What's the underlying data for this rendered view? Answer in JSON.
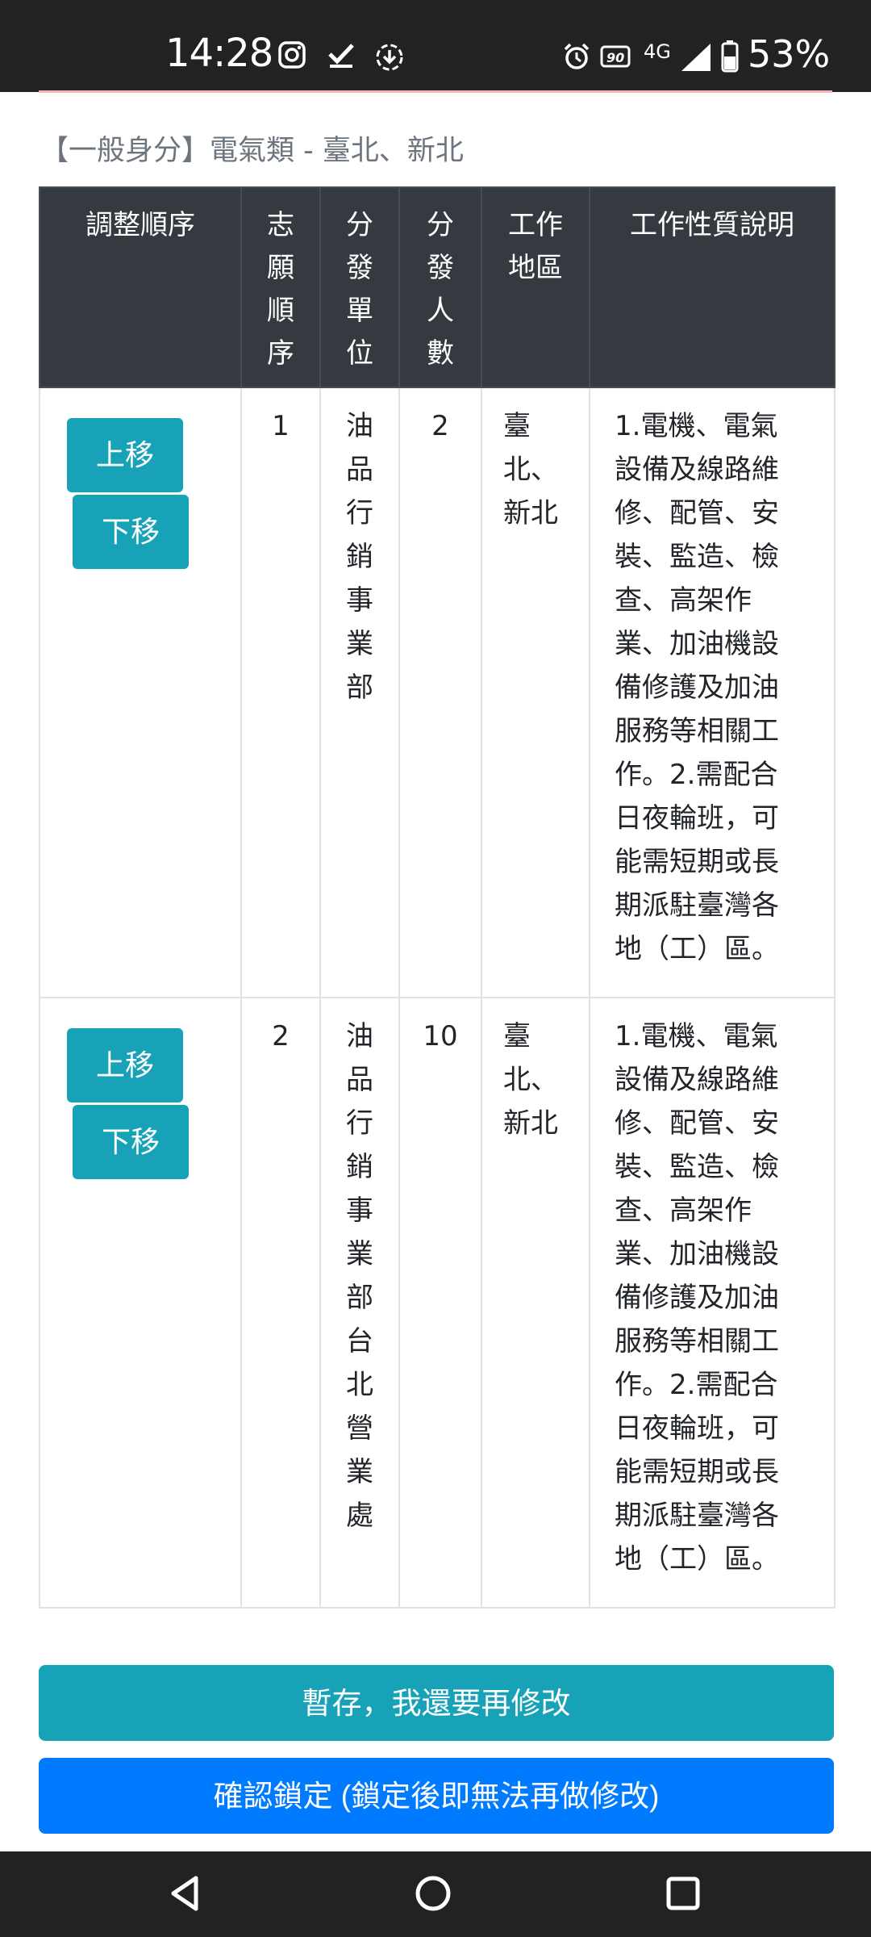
{
  "status_bar": {
    "time": "14:28",
    "network": "4G",
    "battery": "53%"
  },
  "section": {
    "title": "【一般身分】電氣類 - 臺北、新北"
  },
  "table": {
    "headers": {
      "adjust": "調整順序",
      "order": "志願順序",
      "unit": "分發單位",
      "count": "分發人數",
      "area": "工作地區",
      "desc": "工作性質說明"
    },
    "rows": [
      {
        "up_label": "上移",
        "down_label": "下移",
        "order": "1",
        "unit": "油品行銷事業部",
        "count": "2",
        "area": "臺北、新北",
        "desc": "1.電機、電氣設備及線路維修、配管、安裝、監造、檢查、高架作業、加油機設備修護及加油服務等相關工作。2.需配合日夜輪班，可能需短期或長期派駐臺灣各地（工）區。"
      },
      {
        "up_label": "上移",
        "down_label": "下移",
        "order": "2",
        "unit": "油品行銷事業部台北營業處",
        "count": "10",
        "area": "臺北、新北",
        "desc": "1.電機、電氣設備及線路維修、配管、安裝、監造、檢查、高架作業、加油機設備修護及加油服務等相關工作。2.需配合日夜輪班，可能需短期或長期派駐臺灣各地（工）區。"
      }
    ]
  },
  "actions": {
    "save_label": "暫存，我還要再修改",
    "confirm_label": "確認鎖定 (鎖定後即無法再做修改)"
  },
  "colors": {
    "header_bg": "#343a40",
    "info": "#17a2b8",
    "primary": "#007bff",
    "status_bar": "#222222"
  },
  "icons": [
    "instagram-icon",
    "checkmark-icon",
    "download-icon",
    "alarm-icon",
    "hd-voice-icon",
    "signal-icon",
    "battery-icon",
    "back-icon",
    "home-icon",
    "recents-icon"
  ]
}
